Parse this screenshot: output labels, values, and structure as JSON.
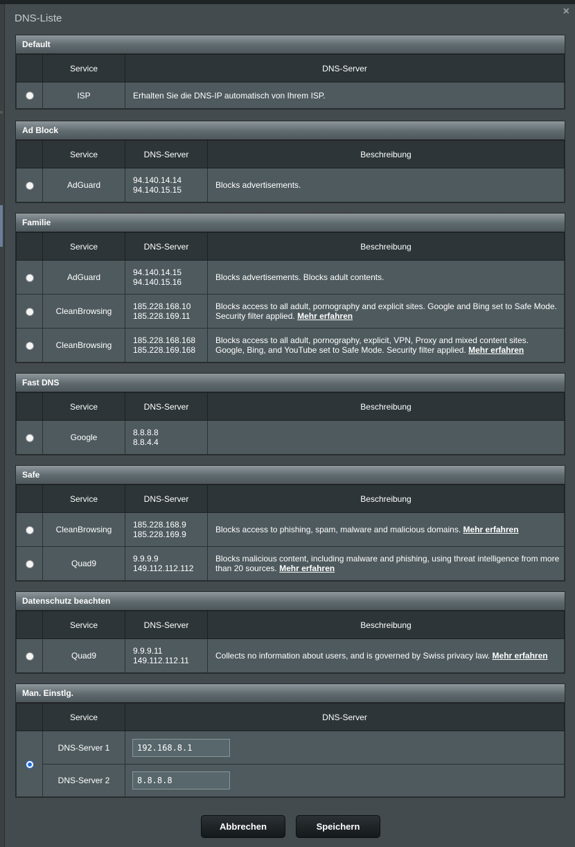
{
  "dialog": {
    "title": "DNS-Liste"
  },
  "sections": {
    "default": {
      "title": "Default",
      "col_service": "Service",
      "col_dns": "DNS-Server",
      "row": {
        "service": "ISP",
        "desc": "Erhalten Sie die DNS-IP automatisch von Ihrem ISP."
      }
    },
    "adblock": {
      "title": "Ad Block",
      "col_service": "Service",
      "col_dns": "DNS-Server",
      "col_desc": "Beschreibung",
      "rows": [
        {
          "service": "AdGuard",
          "ip1": "94.140.14.14",
          "ip2": "94.140.15.15",
          "desc": "Blocks advertisements."
        }
      ]
    },
    "familie": {
      "title": "Familie",
      "col_service": "Service",
      "col_dns": "DNS-Server",
      "col_desc": "Beschreibung",
      "rows": [
        {
          "service": "AdGuard",
          "ip1": "94.140.14.15",
          "ip2": "94.140.15.16",
          "desc": "Blocks advertisements. Blocks adult contents."
        },
        {
          "service": "CleanBrowsing",
          "ip1": "185.228.168.10",
          "ip2": "185.228.169.11",
          "desc": "Blocks access to all adult, pornography and explicit sites. Google and Bing set to Safe Mode. Security filter applied.",
          "link": "Mehr erfahren"
        },
        {
          "service": "CleanBrowsing",
          "ip1": "185.228.168.168",
          "ip2": "185.228.169.168",
          "desc": "Blocks access to all adult, pornography, explicit, VPN, Proxy and mixed content sites. Google, Bing, and YouTube set to Safe Mode. Security filter applied.",
          "link": "Mehr erfahren"
        }
      ]
    },
    "fastdns": {
      "title": "Fast DNS",
      "col_service": "Service",
      "col_dns": "DNS-Server",
      "col_desc": "Beschreibung",
      "rows": [
        {
          "service": "Google",
          "ip1": "8.8.8.8",
          "ip2": "8.8.4.4",
          "desc": ""
        }
      ]
    },
    "safe": {
      "title": "Safe",
      "col_service": "Service",
      "col_dns": "DNS-Server",
      "col_desc": "Beschreibung",
      "rows": [
        {
          "service": "CleanBrowsing",
          "ip1": "185.228.168.9",
          "ip2": "185.228.169.9",
          "desc": "Blocks access to phishing, spam, malware and malicious domains.",
          "link": "Mehr erfahren"
        },
        {
          "service": "Quad9",
          "ip1": "9.9.9.9",
          "ip2": "149.112.112.112",
          "desc": "Blocks malicious content, including malware and phishing, using threat intelligence from more than 20 sources.",
          "link": "Mehr erfahren"
        }
      ]
    },
    "privacy": {
      "title": "Datenschutz beachten",
      "col_service": "Service",
      "col_dns": "DNS-Server",
      "col_desc": "Beschreibung",
      "rows": [
        {
          "service": "Quad9",
          "ip1": "9.9.9.11",
          "ip2": "149.112.112.11",
          "desc": "Collects no information about users, and is governed by Swiss privacy law.",
          "link": "Mehr erfahren"
        }
      ]
    },
    "manual": {
      "title": "Man. Einstlg.",
      "col_service": "Service",
      "col_dns": "DNS-Server",
      "dns1_label": "DNS-Server 1",
      "dns1_value": "192.168.8.1",
      "dns2_label": "DNS-Server 2",
      "dns2_value": "8.8.8.8",
      "selected": true
    }
  },
  "buttons": {
    "cancel": "Abbrechen",
    "save": "Speichern"
  },
  "icons": {
    "close": "close-icon"
  },
  "colors": {
    "radio_selected": "#2a6bd1"
  }
}
